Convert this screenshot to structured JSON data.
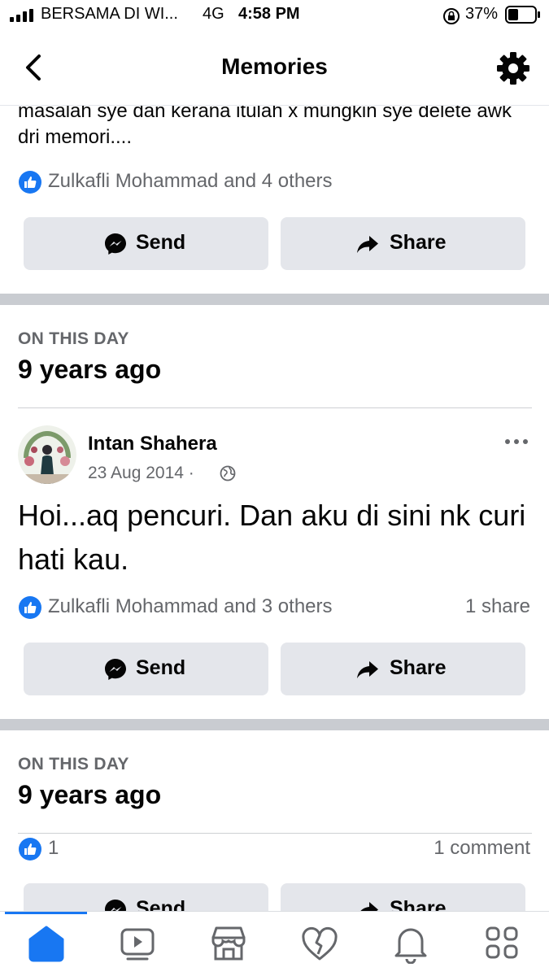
{
  "status_bar": {
    "carrier": "BERSAMA DI WI...",
    "network": "4G",
    "time": "4:58 PM",
    "battery": "37%"
  },
  "header": {
    "title": "Memories",
    "back_icon": "chevron-left-icon",
    "settings_icon": "gear-icon"
  },
  "posts": [
    {
      "text": "masalah sye dan kerana itulah x mungkin sye delete awk dri memori....",
      "reactions": "Zulkafli Mohammad and 4 others"
    },
    {
      "section_label": "ON THIS DAY",
      "section_years": "9 years ago",
      "author": "Intan Shahera",
      "date": "23 Aug 2014 ·",
      "text": "Hoi...aq pencuri. Dan aku di sini nk curi hati kau.",
      "reactions": "Zulkafli Mohammad and 3 others",
      "shares": "1 share"
    },
    {
      "section_label": "ON THIS DAY",
      "section_years": "9 years ago",
      "reactions": "1",
      "comments": "1 comment"
    }
  ],
  "actions": {
    "send": "Send",
    "share": "Share"
  },
  "tabbar": {
    "items": [
      "home-icon",
      "video-icon",
      "marketplace-icon",
      "dating-icon",
      "notifications-icon",
      "menu-icon"
    ]
  },
  "colors": {
    "accent": "#1877f2",
    "button_bg": "#e4e6eb",
    "separator": "#c9ccd1",
    "secondary_text": "#65676b"
  }
}
